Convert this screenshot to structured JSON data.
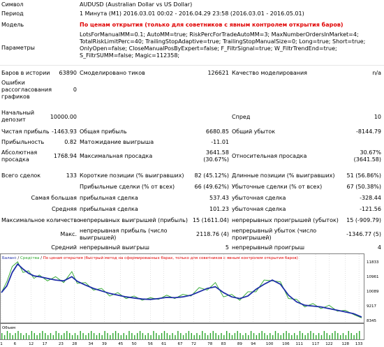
{
  "header": {
    "symbol_label": "Символ",
    "symbol_value": "AUDUSD (Australian Dollar vs US Dollar)",
    "period_label": "Период",
    "period_value": "1 Минута (M1) 2016.03.01 00:02 - 2016.04.29 23:58 (2016.03.01 - 2016.05.01)",
    "model_label": "Модель",
    "model_value": "По ценам открытия (только для советников с явным контролем открытия баров)",
    "params_label": "Параметры",
    "params_lines": [
      "LotsForManualMM=0.1; AutoMM=true; RiskPercForTradeAutoMM=3; MaxNumberOrdersInMarket=4;",
      "TotalRiskLimitPerc=40; TrailingStopAdaptive=true; TrailingStopManualSize=0; Long=true; Short=true;",
      "OnlyOpen=false; CloseManualPosByExpert=false; F_FiltrSignal=true; W_FiltrTrendEnd=true;",
      "S_FiltrSUMM=false; Magic=112358;"
    ]
  },
  "stats": {
    "bars_label": "Баров в истории",
    "bars_value": "63890",
    "ticks_label": "Смоделировано тиков",
    "ticks_value": "126621",
    "quality_label": "Качество моделирования",
    "quality_value": "n/a",
    "errors_label": "Ошибки рассогласования графиков",
    "errors_value": "0",
    "deposit_label": "Начальный депозит",
    "deposit_value": "10000.00",
    "spread_label": "Спред",
    "spread_value": "10",
    "net_label": "Чистая прибыль",
    "net_value": "-1463.93",
    "gross_profit_label": "Общая прибыль",
    "gross_profit_value": "6680.85",
    "gross_loss_label": "Общий убыток",
    "gross_loss_value": "-8144.79",
    "pf_label": "Прибыльность",
    "pf_value": "0.82",
    "expected_label": "Матожидание выигрыша",
    "expected_value": "-11.01",
    "abs_dd_label": "Абсолютная просадка",
    "abs_dd_value": "1768.94",
    "max_dd_label": "Максимальная просадка",
    "max_dd_value": "3641.58",
    "max_dd_pct": "(30.67%)",
    "rel_dd_label": "Относительная просадка",
    "rel_dd_value": "30.67%",
    "rel_dd_money": "(3641.58)",
    "total_trades_label": "Всего сделок",
    "total_trades_value": "133",
    "short_label": "Короткие позиции (% выигравших)",
    "short_value": "82 (45.12%)",
    "long_label": "Длинные позиции (% выигравших)",
    "long_value": "51 (56.86%)",
    "profit_trades_label": "Прибыльные сделки (% от всех)",
    "profit_trades_value": "66 (49.62%)",
    "loss_trades_label": "Убыточные сделки (% от всех)",
    "loss_trades_value": "67 (50.38%)",
    "largest_label": "Самая большая",
    "largest_profit_label": "прибыльная сделка",
    "largest_profit_value": "537.43",
    "largest_loss_label": "убыточная сделка",
    "largest_loss_value": "-328.44",
    "average_label": "Средняя",
    "avg_profit_label": "прибыльная сделка",
    "avg_profit_value": "101.23",
    "avg_loss_label": "убыточная сделка",
    "avg_loss_value": "-121.56",
    "max_count_label": "Максимальное количество",
    "max_cons_wins_label": "непрерывных выигрышей (прибыль)",
    "max_cons_wins_value": "15 (1611.04)",
    "max_cons_losses_label": "непрерывных проигрышей (убыток)",
    "max_cons_losses_value": "15 (-909.79)",
    "max_label": "Макс.",
    "max_cons_profit_label": "непрерывная прибыль (число выигрышей)",
    "max_cons_profit_value": "2118.76 (4)",
    "max_cons_loss_label": "непрерывный убыток (число проигрышей)",
    "max_cons_loss_value": "-1346.77 (5)",
    "avg_cons_label": "Средний",
    "avg_cons_wins_label": "непрерывный выигрыш",
    "avg_cons_wins_value": "5",
    "avg_cons_losses_label": "непрерывный проигрыш",
    "avg_cons_losses_value": "4"
  },
  "chart_data": {
    "type": "line",
    "legend": "Баланс / Средства / По ценам открытия (быстрый метод на сформированных барах, только для советников с явным контролем открытия баров)",
    "legend_balance": "Баланс",
    "legend_equity": "Средства",
    "legend_rest": "По ценам открытия (быстрый метод на сформированных барах, только для советников с явным контролем открытия баров)",
    "volume_label": "Объем",
    "ylim": [
      8345,
      11833
    ],
    "y_ticks": [
      "11833",
      "10961",
      "10089",
      "9217",
      "8345"
    ],
    "x_ticks": [
      "1",
      "6",
      "12",
      "17",
      "23",
      "28",
      "34",
      "39",
      "45",
      "50",
      "56",
      "61",
      "67",
      "72",
      "78",
      "83",
      "89",
      "94",
      "100",
      "106",
      "111",
      "117",
      "122",
      "128",
      "133"
    ],
    "colors": {
      "balance": "#1f2fa8",
      "equity": "#2aa52a",
      "volume": "#2aa52a",
      "axis": "#808080"
    },
    "series": [
      {
        "name": "Баланс",
        "x": [
          0,
          2,
          4,
          6,
          8,
          10,
          12,
          14,
          17,
          20,
          23,
          26,
          28,
          31,
          34,
          37,
          40,
          43,
          46,
          49,
          52,
          55,
          58,
          61,
          64,
          67,
          70,
          73,
          76,
          79,
          82,
          85,
          88,
          91,
          94,
          97,
          100,
          103,
          106,
          109,
          112,
          115,
          118,
          121,
          124,
          127,
          130,
          133
        ],
        "values": [
          10000,
          10400,
          11200,
          11700,
          11400,
          11150,
          11000,
          10950,
          10850,
          10750,
          10700,
          10950,
          10680,
          10450,
          10250,
          10100,
          9950,
          9850,
          9750,
          9680,
          9620,
          9600,
          9650,
          9720,
          9700,
          9750,
          9850,
          10050,
          10250,
          10350,
          10000,
          9750,
          9650,
          9800,
          10200,
          10500,
          10750,
          10500,
          9850,
          9450,
          9250,
          9200,
          9150,
          9050,
          8950,
          8850,
          8750,
          8550
        ]
      },
      {
        "name": "Средства",
        "x": [
          0,
          2,
          4,
          6,
          8,
          10,
          12,
          14,
          17,
          20,
          23,
          26,
          28,
          31,
          34,
          37,
          40,
          43,
          46,
          49,
          52,
          55,
          58,
          61,
          64,
          67,
          70,
          73,
          76,
          79,
          82,
          85,
          88,
          91,
          94,
          97,
          100,
          103,
          106,
          109,
          112,
          115,
          118,
          121,
          124,
          127,
          130,
          133
        ],
        "values": [
          10000,
          10650,
          11550,
          11833,
          11200,
          11300,
          10850,
          11050,
          10700,
          10950,
          10600,
          11250,
          10550,
          10600,
          10150,
          10250,
          9800,
          10000,
          9650,
          9800,
          9550,
          9700,
          9600,
          9850,
          9650,
          9900,
          9800,
          10300,
          10150,
          10600,
          9750,
          9900,
          9550,
          10050,
          10050,
          10750,
          10700,
          10650,
          9650,
          9600,
          9150,
          9350,
          9050,
          9250,
          8900,
          8950,
          8700,
          8500
        ]
      }
    ],
    "volume": [
      3,
      2,
      4,
      3,
      2,
      3,
      4,
      3,
      2,
      3,
      2,
      4,
      3,
      2,
      3,
      4,
      3,
      2,
      3,
      2,
      4,
      3,
      2,
      3,
      4,
      3,
      2,
      3,
      2,
      4,
      3,
      2,
      3,
      4,
      3,
      2,
      3,
      2,
      4,
      3,
      2,
      3,
      4,
      3,
      2,
      3,
      2,
      4,
      3,
      2,
      3,
      4,
      3,
      2,
      3,
      2,
      4,
      3,
      2,
      3,
      4,
      3,
      2,
      3,
      2,
      4,
      3,
      2,
      3,
      4,
      3,
      2,
      3,
      2,
      4,
      3,
      2,
      3,
      4,
      3,
      2,
      3,
      2,
      4,
      3,
      2,
      3,
      4,
      3,
      2,
      3,
      2,
      4,
      3,
      2,
      3,
      4,
      3,
      2,
      3,
      2,
      4,
      3,
      2,
      3,
      4,
      3,
      2,
      3,
      2,
      4,
      3,
      2,
      3,
      4,
      3,
      2,
      3,
      2,
      4,
      3,
      2,
      3,
      4,
      3,
      2,
      3,
      2,
      4,
      3,
      2,
      3,
      4
    ]
  }
}
